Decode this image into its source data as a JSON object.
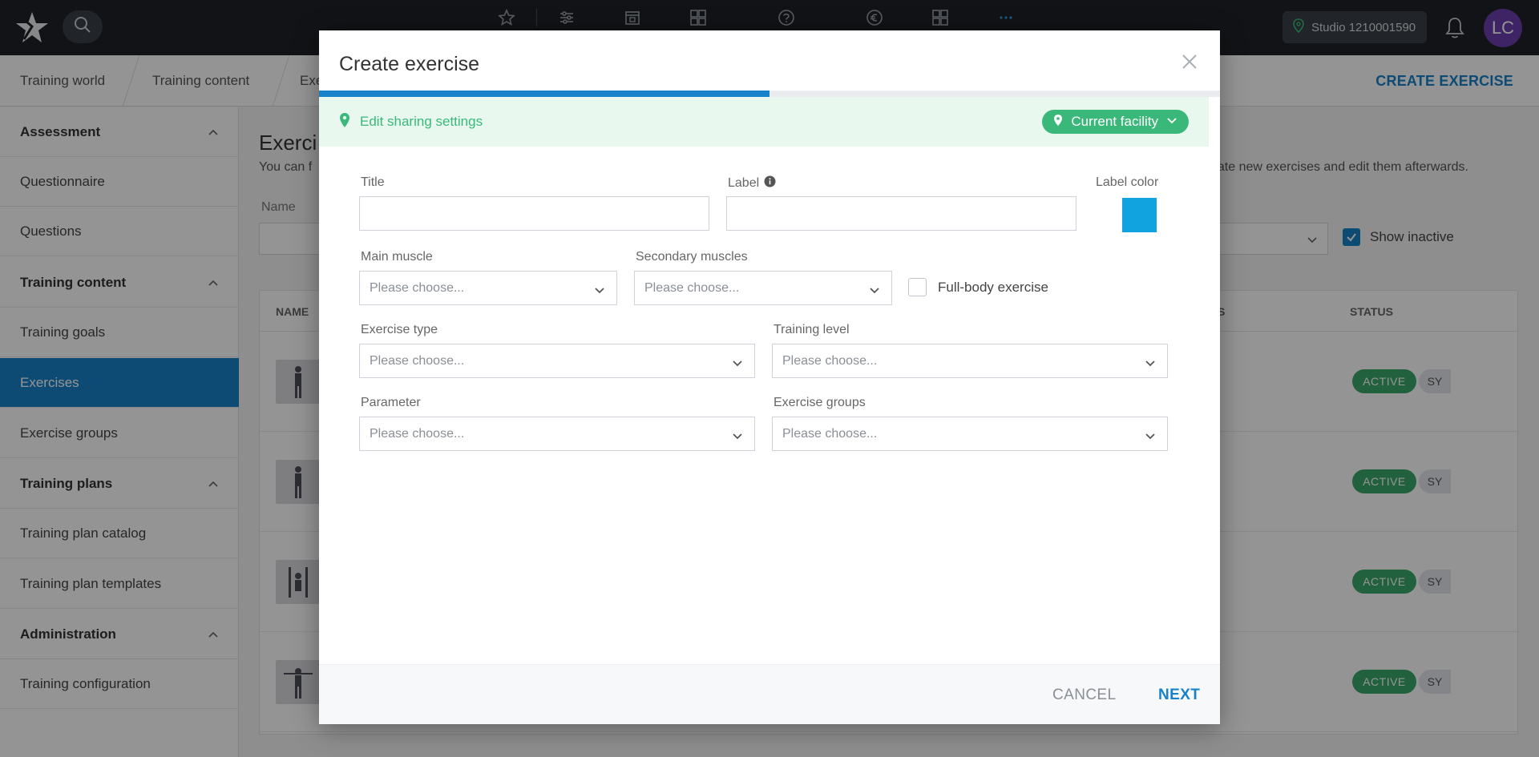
{
  "topbar": {
    "studio_label": "Studio 1210001590",
    "avatar_initials": "LC",
    "icons": [
      "star-icon",
      "sliders-icon",
      "calendar-icon",
      "grid-icon",
      "help-icon",
      "euro-icon",
      "apps-icon",
      "more-icon"
    ]
  },
  "breadcrumb": {
    "items": [
      "Training world",
      "Training content",
      "Exe"
    ],
    "action": "CREATE EXERCISE"
  },
  "sidebar": {
    "items": [
      {
        "label": "Assessment",
        "type": "header"
      },
      {
        "label": "Questionnaire",
        "type": "item"
      },
      {
        "label": "Questions",
        "type": "item"
      },
      {
        "label": "Training content",
        "type": "header"
      },
      {
        "label": "Training goals",
        "type": "item"
      },
      {
        "label": "Exercises",
        "type": "active"
      },
      {
        "label": "Exercise groups",
        "type": "item"
      },
      {
        "label": "Training plans",
        "type": "header"
      },
      {
        "label": "Training plan catalog",
        "type": "item"
      },
      {
        "label": "Training plan templates",
        "type": "item"
      },
      {
        "label": "Administration",
        "type": "header"
      },
      {
        "label": "Training configuration",
        "type": "item"
      }
    ]
  },
  "main": {
    "title": "Exerci",
    "desc_left": "You can f",
    "desc_right": "eate new exercises and edit them afterwards.",
    "name_label": "Name",
    "show_inactive": "Show inactive",
    "table": {
      "col_name": "NAME",
      "col_s": "S",
      "col_status": "STATUS",
      "rows": [
        {
          "status": "ACTIVE",
          "type": "SY"
        },
        {
          "status": "ACTIVE",
          "type": "SY"
        },
        {
          "status": "ACTIVE",
          "type": "SY"
        },
        {
          "status": "ACTIVE",
          "type": "SY"
        }
      ]
    }
  },
  "modal": {
    "title": "Create exercise",
    "progress": 0.5,
    "sharing": {
      "link": "Edit sharing settings",
      "pill": "Current facility"
    },
    "fields": {
      "title": {
        "label": "Title",
        "value": ""
      },
      "label": {
        "label": "Label",
        "value": ""
      },
      "label_color": {
        "label": "Label color",
        "value": "#11a3df"
      },
      "main_muscle": {
        "label": "Main muscle",
        "placeholder": "Please choose..."
      },
      "secondary_muscles": {
        "label": "Secondary muscles",
        "placeholder": "Please choose..."
      },
      "full_body": {
        "label": "Full-body exercise",
        "checked": false
      },
      "exercise_type": {
        "label": "Exercise type",
        "placeholder": "Please choose..."
      },
      "training_level": {
        "label": "Training level",
        "placeholder": "Please choose..."
      },
      "parameter": {
        "label": "Parameter",
        "placeholder": "Please choose..."
      },
      "exercise_groups": {
        "label": "Exercise groups",
        "placeholder": "Please choose..."
      }
    },
    "footer": {
      "cancel": "CANCEL",
      "next": "NEXT"
    }
  },
  "colors": {
    "accent": "#1782c9",
    "success": "#3ab87a",
    "topbar": "#1f2227",
    "avatar": "#6d3fae"
  }
}
